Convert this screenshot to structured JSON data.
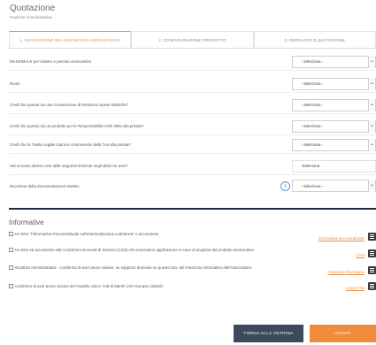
{
  "page": {
    "title": "Quotazione",
    "subtitle": "Giustizia Amministrativa"
  },
  "steps": [
    {
      "label": "1. DESCRIZIONE DEL RISCHIO ED ADEGUATEZZA",
      "active": true
    },
    {
      "label": "2. CONFIGURAZIONE PRODOTTO",
      "active": false
    },
    {
      "label": "3. RIEPILOGO E QUOTAZIONE",
      "active": false
    }
  ],
  "questions": [
    {
      "label": "MASSIMALE per sinistro e periodo assicurativo",
      "value": "- Seleziona -"
    },
    {
      "label": "Ruolo",
      "value": "- Seleziona -"
    },
    {
      "label": "Credi che questa sia una Convenzione di Rimborso Spese Mediche?",
      "value": "- Seleziona -"
    },
    {
      "label": "Credi che questo sia un prodotto per le Responsabilità Civili della vita privata?",
      "value": "- Seleziona -"
    },
    {
      "label": "Credi che la Tutela Legale copra le controversie della Tua vita privata?",
      "value": "- Seleziona -"
    },
    {
      "label": "Hai ricevuto almeno una delle seguenti richieste negli ultimi tre anni?",
      "value": "-Seleziona-"
    },
    {
      "label": "Ricezione della documentazione tramite:",
      "value": "- Seleziona -"
    }
  ],
  "info_icon": "info-icon",
  "informative": {
    "heading": "Informative",
    "items": [
      {
        "text": "Ho letto \"l'informativa Precontrattuale sull'Intermediazione a distanza\" e acconsento.",
        "link": "Informativa precontrattuale"
      },
      {
        "text": "Ho letto ed acconsento alle Condizioni Generali di Servizio (CGS) che troveranno applicazione in caso di acquisto del prodotto assicurativo",
        "link": "CGS"
      },
      {
        "text": "Giustizia Amministrativa - Conferma di aver preso visione, su supporto durevole su questo sito, del Fascicolo Informativo dell'Assicuratore.",
        "link": "Fascicolo Informativo"
      },
      {
        "text": "Confermo di aver preso visione del modello Unico 7AB di Marsh (AIG Europe Limited)",
        "link": "Unico 7AB"
      }
    ]
  },
  "buttons": {
    "back": "TORNA ALLA VETRINA",
    "next": "AVANTI"
  },
  "colors": {
    "accent": "#f08c3c",
    "dark": "#3d4a5c",
    "divider": "#1e2d44",
    "info": "#5a9bd5"
  }
}
